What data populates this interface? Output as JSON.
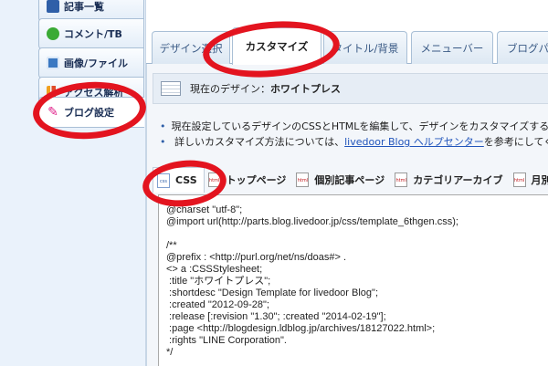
{
  "sidebar": {
    "items": [
      {
        "label": "記事一覧",
        "icon": "document-icon"
      },
      {
        "label": "コメント/TB",
        "icon": "comment-icon"
      },
      {
        "label": "画像/ファイル",
        "icon": "image-icon"
      },
      {
        "label": "アクセス解析",
        "icon": "chart-icon"
      },
      {
        "label": "ブログ設定",
        "icon": "wrench-icon"
      }
    ]
  },
  "tabs": [
    {
      "label": "デザイン選択"
    },
    {
      "label": "カスタマイズ"
    },
    {
      "label": "タイトル/背景"
    },
    {
      "label": "メニューバー"
    },
    {
      "label": "ブログパ"
    }
  ],
  "current_design": {
    "prefix": "現在のデザイン：",
    "name": "ホワイトプレス"
  },
  "notes": {
    "line1": "現在設定しているデザインのCSSとHTMLを編集して、デザインをカスタマイズするこ",
    "line2_before": "詳しいカスタマイズ方法については、",
    "line2_link": "livedoor Blog ヘルプセンター",
    "line2_after": "を参考にしてくださ"
  },
  "file_tabs": [
    {
      "label": "CSS",
      "icon": "css"
    },
    {
      "label": "トップページ",
      "icon": "html"
    },
    {
      "label": "個別記事ページ",
      "icon": "html"
    },
    {
      "label": "カテゴリアーカイブ",
      "icon": "html"
    },
    {
      "label": "月別",
      "icon": "html"
    }
  ],
  "code_lines": [
    "@charset \"utf-8\";",
    "@import url(http://parts.blog.livedoor.jp/css/template_6thgen.css);",
    "",
    "/**",
    "@prefix : <http://purl.org/net/ns/doas#> .",
    "<> a :CSSStylesheet;",
    " :title \"ホワイトプレス\";",
    " :shortdesc \"Design Template for livedoor Blog\";",
    " :created \"2012-09-28\";",
    " :release [:revision \"1.30\"; :created \"2014-02-19\"];",
    " :page <http://blogdesign.ldblog.jp/archives/18127022.html>;",
    " :rights \"LINE Corporation\".",
    "*/"
  ],
  "colors": {
    "highlight": "#e3141f",
    "link": "#2255bb",
    "sidebar_text": "#1b2f55"
  }
}
